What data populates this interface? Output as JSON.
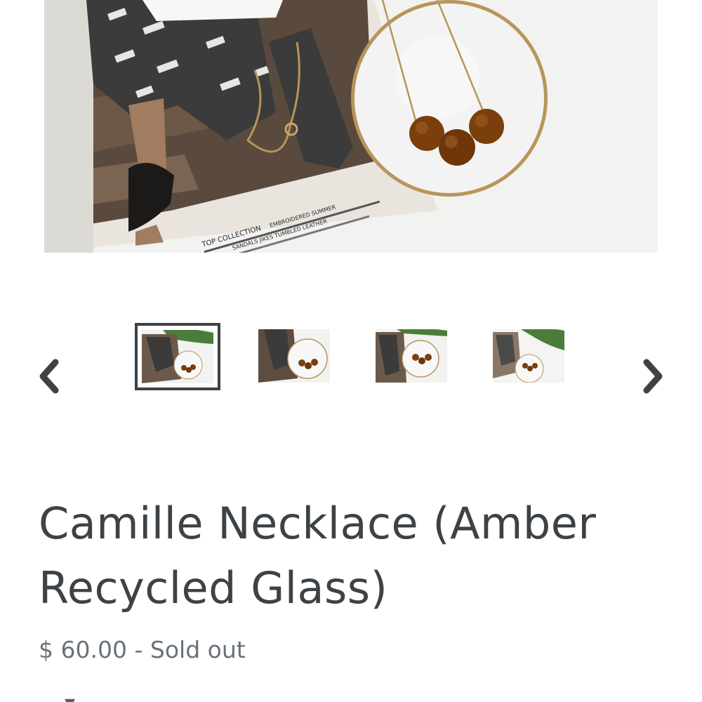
{
  "product": {
    "title": "Camille Necklace (Amber Recycled Glass)",
    "price": "$ 60.00",
    "separator": "-",
    "status": "Sold out",
    "cut_off_text": "▾ ..."
  },
  "gallery": {
    "thumbnail_count": 4,
    "active_thumbnail": 1,
    "prev_icon": "chevron-left-icon",
    "next_icon": "chevron-right-icon"
  },
  "photo_caption_text": {
    "magazine_heading": "TOP COLLECTION",
    "magazine_line_1": "EMBROIDERED SUMMER",
    "magazine_line_2": "SANDALS JIKES TUMBLED LEATHER"
  },
  "colors": {
    "text": "#3d4246",
    "muted": "#69727b",
    "amber_bead": "#7a3f0c",
    "gold_chain": "#b8955a"
  }
}
